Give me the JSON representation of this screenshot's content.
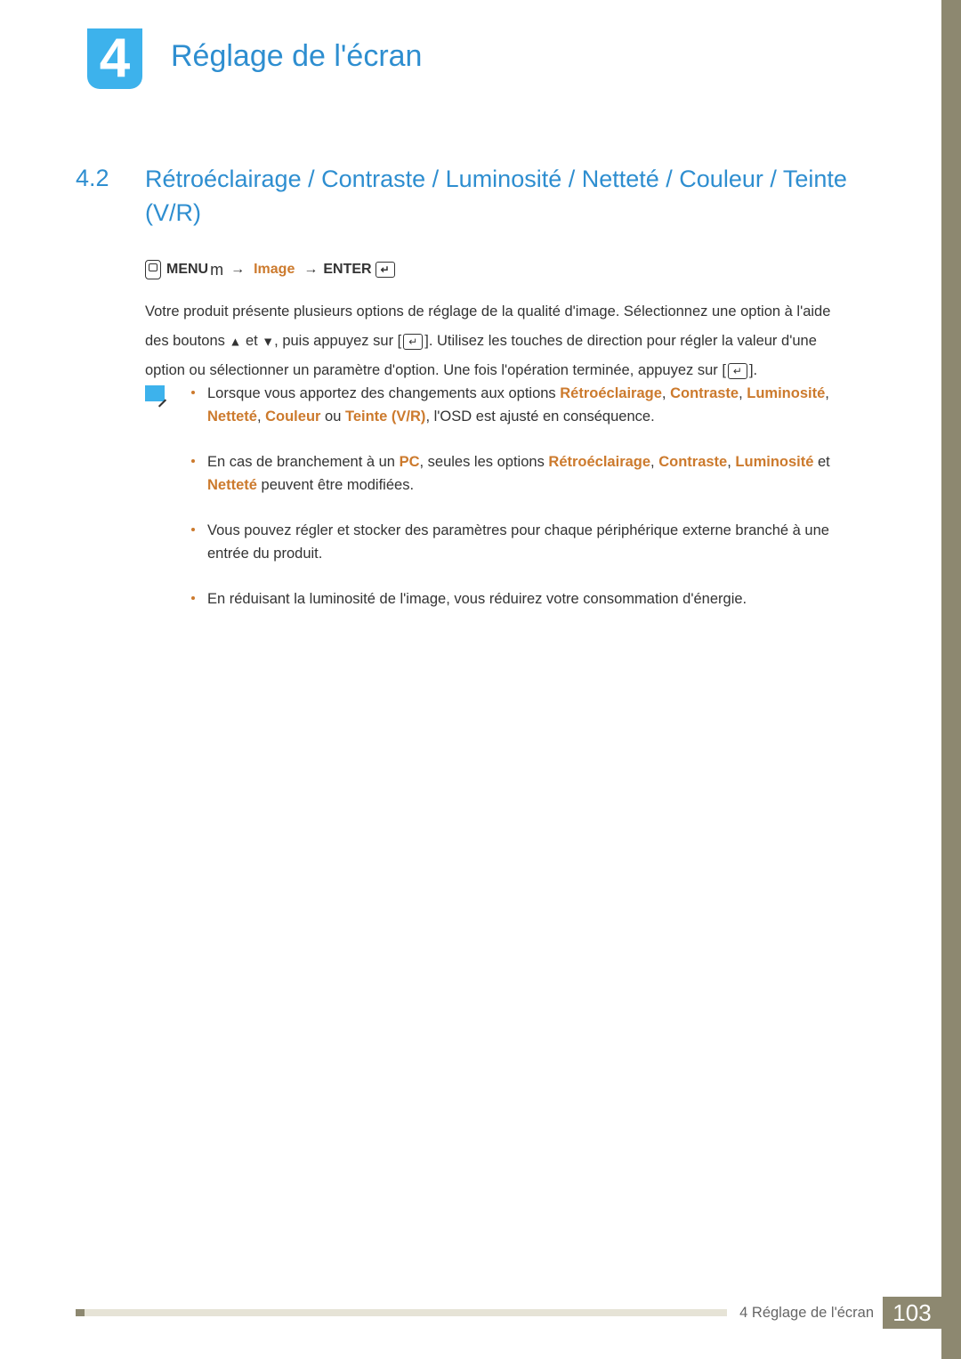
{
  "chapter": {
    "number": "4",
    "title": "Réglage de l'écran"
  },
  "section": {
    "number": "4.2",
    "title": "Rétroéclairage / Contraste / Luminosité / Netteté / Couleur / Teinte (V/R)"
  },
  "nav": {
    "menu": "MENU",
    "m": "m",
    "arrow1": "→",
    "image": "Image",
    "arrow2": "→",
    "enter": "ENTER",
    "enter_glyph": "↵"
  },
  "body": {
    "p1a": "Votre produit présente plusieurs options de réglage de la qualité d'image. Sélectionnez une option à l'aide des boutons ",
    "p1b": " et ",
    "p1c": ", puis appuyez sur [",
    "p1d": "]. Utilisez les touches de direction pour régler la valeur d'une option ou sélectionner un paramètre d'option. Une fois l'opération terminée, appuyez sur [",
    "p1e": "].",
    "tri_up": "▲",
    "tri_down": "▼",
    "enter_glyph": "↵"
  },
  "notes": {
    "n1": {
      "pre": "Lorsque vous apportez des changements aux options ",
      "h1": "Rétroéclairage",
      "c1": ", ",
      "h2": "Contraste",
      "c2": ", ",
      "h3": "Luminosité",
      "c3": ", ",
      "h4": "Netteté",
      "c4": ", ",
      "h5": "Couleur",
      "c5": " ou ",
      "h6": "Teinte (V/R)",
      "post": ", l'OSD est ajusté en conséquence."
    },
    "n2": {
      "pre": "En cas de branchement à un ",
      "h1": "PC",
      "c1": ", seules les options ",
      "h2": "Rétroéclairage",
      "c2": ", ",
      "h3": "Contraste",
      "c3": ", ",
      "h4": "Luminosité",
      "c4": " et ",
      "h5": "Netteté",
      "post": " peuvent être modifiées."
    },
    "n3": "Vous pouvez régler et stocker des paramètres pour chaque périphérique externe branché à une entrée du produit.",
    "n4": "En réduisant la luminosité de l'image, vous réduirez votre consommation d'énergie."
  },
  "footer": {
    "label": "4 Réglage de l'écran",
    "page": "103"
  }
}
